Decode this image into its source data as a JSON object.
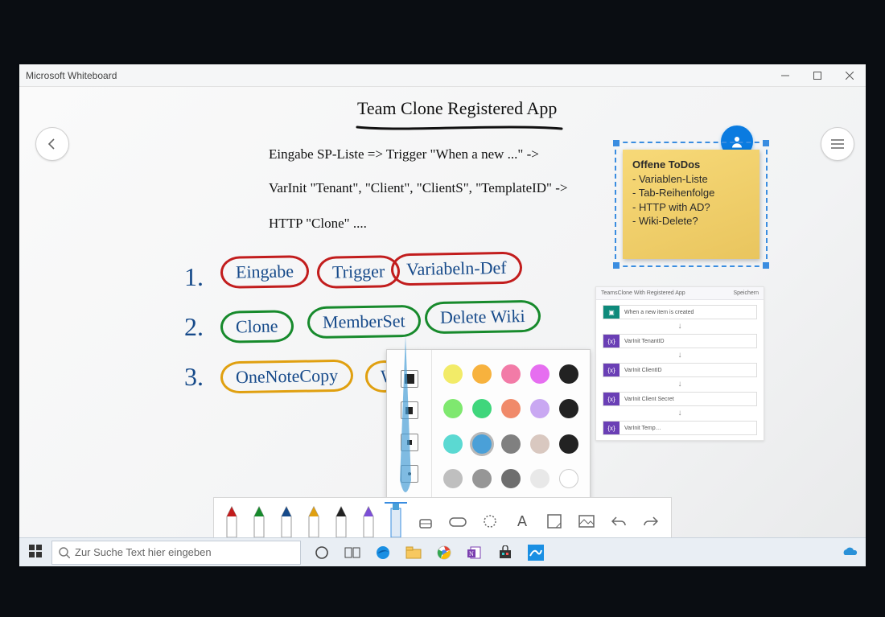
{
  "window": {
    "title": "Microsoft Whiteboard"
  },
  "canvas": {
    "title": "Team Clone Registered App",
    "notes": {
      "line1": "Eingabe SP-Liste =>   Trigger \"When a new ...\" ->",
      "line2": "VarInit \"Tenant\", \"Client\", \"ClientS\", \"TemplateID\" ->",
      "line3": "HTTP \"Clone\" ...."
    },
    "list": {
      "n1": "1.",
      "n2": "2.",
      "n3": "3."
    },
    "bubbles": {
      "eingabe": "Eingabe",
      "trigger": "Trigger",
      "variabeln": "Variabeln-Def",
      "clone": "Clone",
      "memberset": "MemberSet",
      "deletewiki": "Delete Wiki",
      "onenote": "OneNoteCopy",
      "w": "W"
    }
  },
  "sticky": {
    "title": "Offene ToDos",
    "items": [
      "- Variablen-Liste",
      "- Tab-Reihenfolge",
      "- HTTP with AD?",
      "- Wiki-Delete?"
    ]
  },
  "flow": {
    "header": "TeamsClone With Registered App",
    "save": "Speichern",
    "steps": [
      {
        "color": "#0e8a7b",
        "label": "When a new item is created"
      },
      {
        "color": "#6a3fb5",
        "label": "VarInit TenantID"
      },
      {
        "color": "#6a3fb5",
        "label": "VarInit ClientID"
      },
      {
        "color": "#6a3fb5",
        "label": "VarInit Client Secret"
      },
      {
        "color": "#6a3fb5",
        "label": "VarInit Temp…"
      }
    ]
  },
  "picker": {
    "colors_row1": [
      "#f2eb68",
      "#f7b23e",
      "#f27ba7",
      "#e66ef0"
    ],
    "colors_row2": [
      "#7fe86f",
      "#3fd67c",
      "#f08a6a",
      "#c9a8f2"
    ],
    "colors_row3": [
      "#5bd9d2",
      "#4aa0d8",
      "#808080",
      "#d9c8c0"
    ],
    "colors_row4": [
      "#bfbfbf",
      "#969696",
      "#6e6e6e",
      "#e8e8e8"
    ],
    "selected": "#4aa0d8"
  },
  "taskbar": {
    "search_placeholder": "Zur Suche Text hier eingeben"
  }
}
